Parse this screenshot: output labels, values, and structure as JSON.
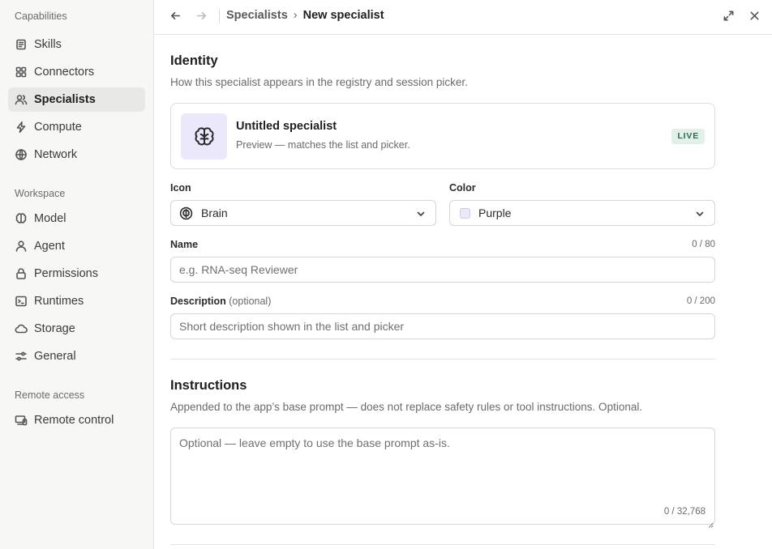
{
  "sidebar": {
    "sections": [
      {
        "label": "Capabilities",
        "items": [
          {
            "label": "Skills",
            "icon": "skills-icon"
          },
          {
            "label": "Connectors",
            "icon": "connectors-icon"
          },
          {
            "label": "Specialists",
            "icon": "specialists-icon",
            "active": true
          },
          {
            "label": "Compute",
            "icon": "compute-icon"
          },
          {
            "label": "Network",
            "icon": "globe-icon"
          }
        ]
      },
      {
        "label": "Workspace",
        "items": [
          {
            "label": "Model",
            "icon": "brain-icon"
          },
          {
            "label": "Agent",
            "icon": "agent-icon"
          },
          {
            "label": "Permissions",
            "icon": "lock-icon"
          },
          {
            "label": "Runtimes",
            "icon": "terminal-icon"
          },
          {
            "label": "Storage",
            "icon": "cloud-icon"
          },
          {
            "label": "General",
            "icon": "sliders-icon"
          }
        ]
      },
      {
        "label": "Remote access",
        "items": [
          {
            "label": "Remote control",
            "icon": "remote-control-icon"
          }
        ]
      }
    ]
  },
  "header": {
    "breadcrumb_root": "Specialists",
    "breadcrumb_sep": "›",
    "breadcrumb_current": "New specialist"
  },
  "identity": {
    "title": "Identity",
    "description": "How this specialist appears in the registry and session picker.",
    "preview": {
      "name": "Untitled specialist",
      "subtitle": "Preview — matches the list and picker.",
      "badge": "LIVE",
      "icon": "brain-icon"
    },
    "icon_field": {
      "label": "Icon",
      "value": "Brain",
      "icon": "brain-icon"
    },
    "color_field": {
      "label": "Color",
      "value": "Purple",
      "swatch": "#ebe8fc"
    },
    "name_field": {
      "label": "Name",
      "counter": "0 / 80",
      "placeholder": "e.g. RNA-seq Reviewer",
      "value": ""
    },
    "description_field": {
      "label": "Description",
      "optional": "(optional)",
      "counter": "0 / 200",
      "placeholder": "Short description shown in the list and picker",
      "value": ""
    }
  },
  "instructions": {
    "title": "Instructions",
    "description": "Appended to the app’s base prompt — does not replace safety rules or tool instructions. Optional.",
    "placeholder": "Optional — leave empty to use the base prompt as-is.",
    "value": "",
    "counter": "0 / 32,768"
  },
  "colors": {
    "accent_purple_bg": "#ebe8fc",
    "live_bg": "#e3f0ea",
    "live_text": "#2d6a4f"
  }
}
